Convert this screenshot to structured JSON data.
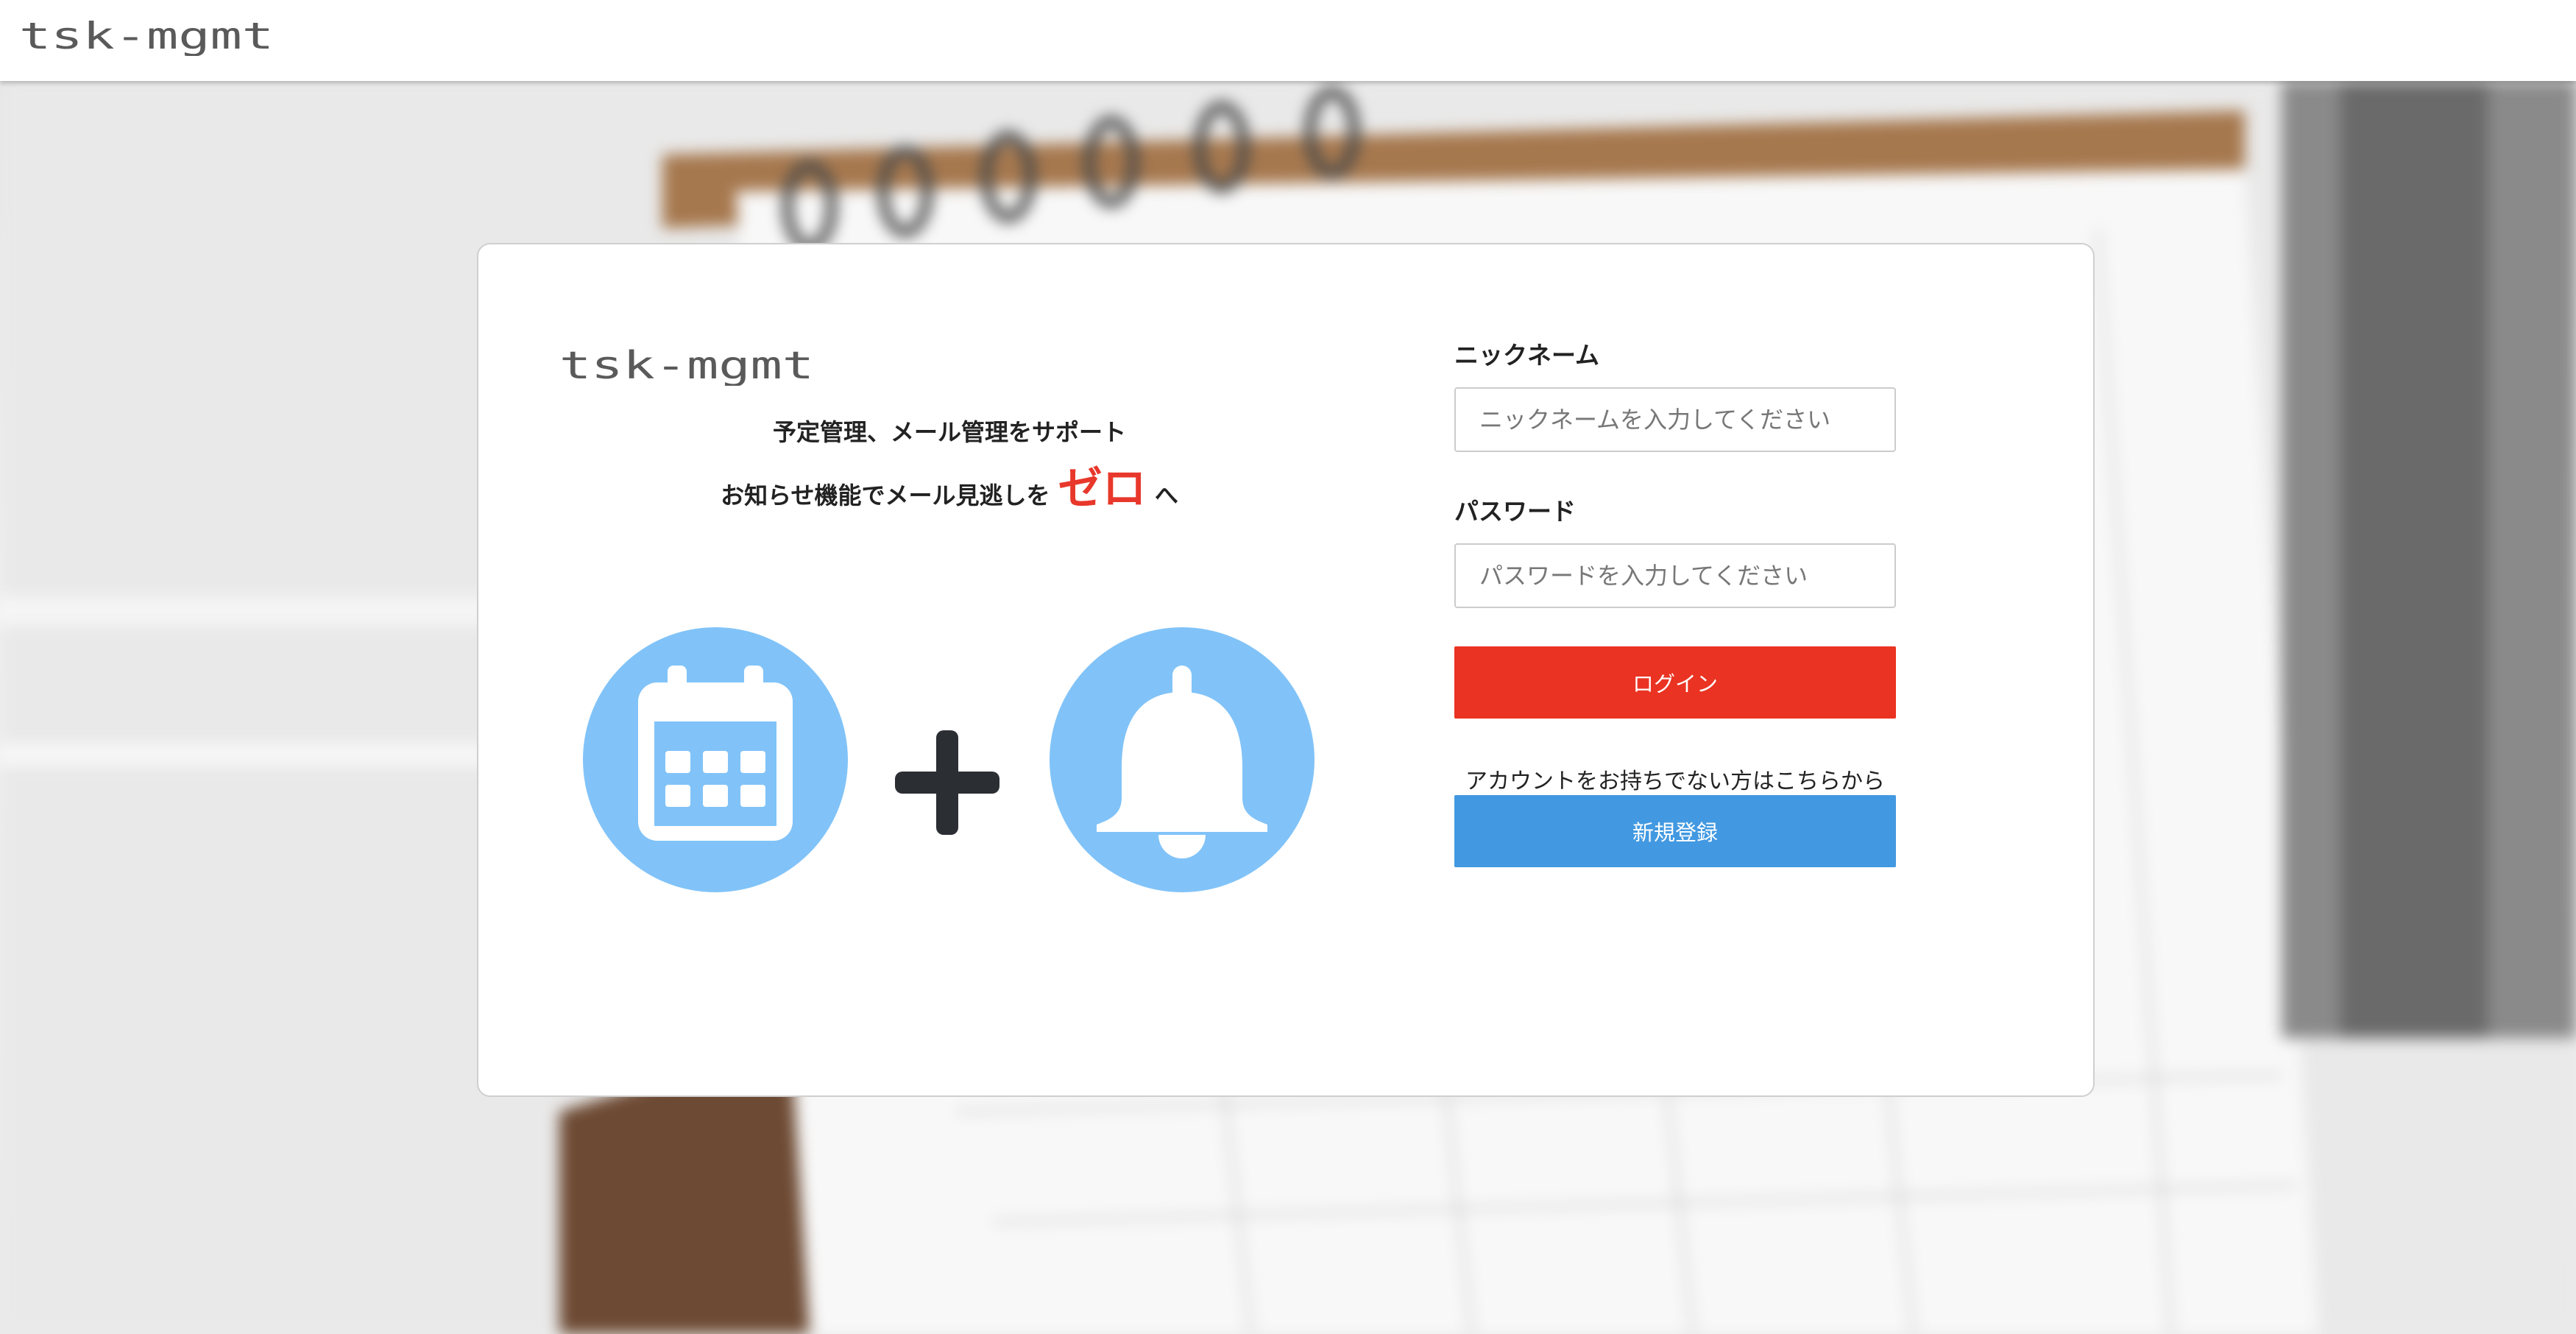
{
  "header": {
    "brand_text": "tsk-mgmt"
  },
  "card": {
    "brand_text": "tsk-mgmt",
    "tagline_line1": "予定管理、メール管理をサポート",
    "tagline_line2_prefix": "お知らせ機能でメール見逃しを",
    "tagline_line2_highlight": "ゼロ",
    "tagline_line2_suffix": "へ",
    "icons": [
      "calendar-icon",
      "plus-icon",
      "bell-icon"
    ]
  },
  "login_form": {
    "nickname_label": "ニックネーム",
    "nickname_placeholder": "ニックネームを入力してください",
    "nickname_value": "",
    "password_label": "パスワード",
    "password_placeholder": "パスワードを入力してください",
    "password_value": "",
    "login_button": "ログイン",
    "register_note": "アカウントをお持ちでない方はこちらから",
    "register_button": "新規登録"
  },
  "colors": {
    "accent_red": "#ea3322",
    "accent_blue": "#4299e1",
    "icon_blue": "#81c3f8",
    "icon_dark": "#2b2e33",
    "brand_gray": "#5a5a5a"
  }
}
